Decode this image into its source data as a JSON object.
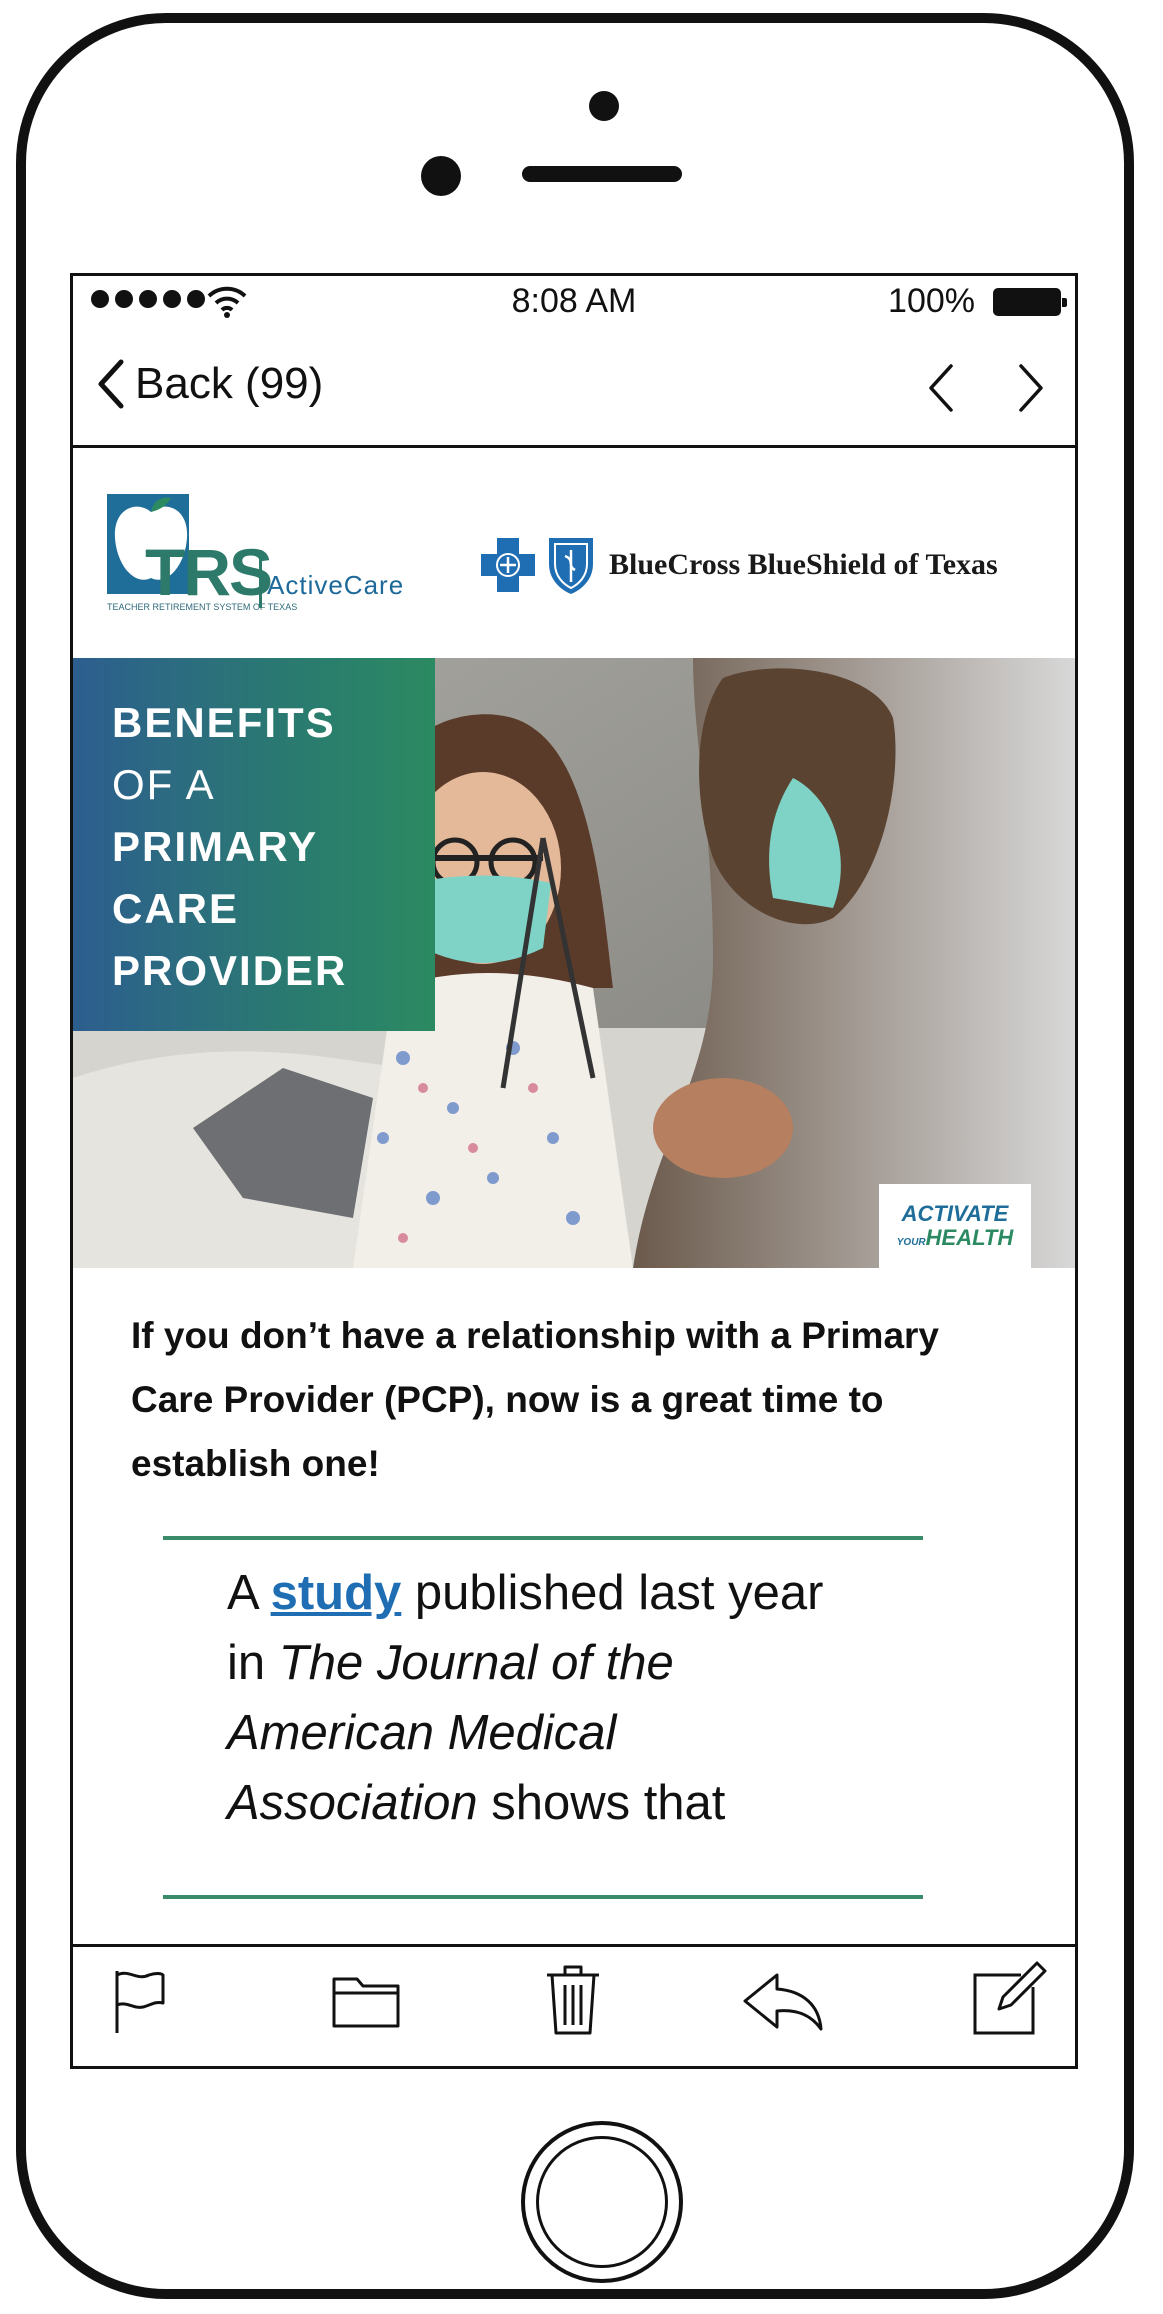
{
  "status_bar": {
    "time": "8:08 AM",
    "battery": "100%"
  },
  "nav": {
    "back_label": "Back (99)"
  },
  "email": {
    "logos": {
      "trs_wordmark": "TRS",
      "trs_subtitle": "TEACHER RETIREMENT SYSTEM OF TEXAS",
      "trs_product": "ActiveCare",
      "bcbs_name": "BlueCross BlueShield of Texas"
    },
    "hero": {
      "title_lines": [
        "BENEFITS",
        "OF A",
        "PRIMARY",
        "CARE",
        "PROVIDER"
      ],
      "badge_line1": "ACTIVATE",
      "badge_line2_small": "YOUR",
      "badge_line2": "HEALTH"
    },
    "intro": "If you don’t have a relationship with a Primary Care Provider (PCP), now is a great time to establish one!",
    "quote": {
      "prefix": "A ",
      "link": "study",
      "part1": " published last year in ",
      "journal": "The Journal of the American Medical Association",
      "part2": " shows that"
    }
  },
  "toolbar": {
    "items": [
      "flag-icon",
      "folder-icon",
      "trash-icon",
      "reply-icon",
      "compose-icon"
    ]
  }
}
